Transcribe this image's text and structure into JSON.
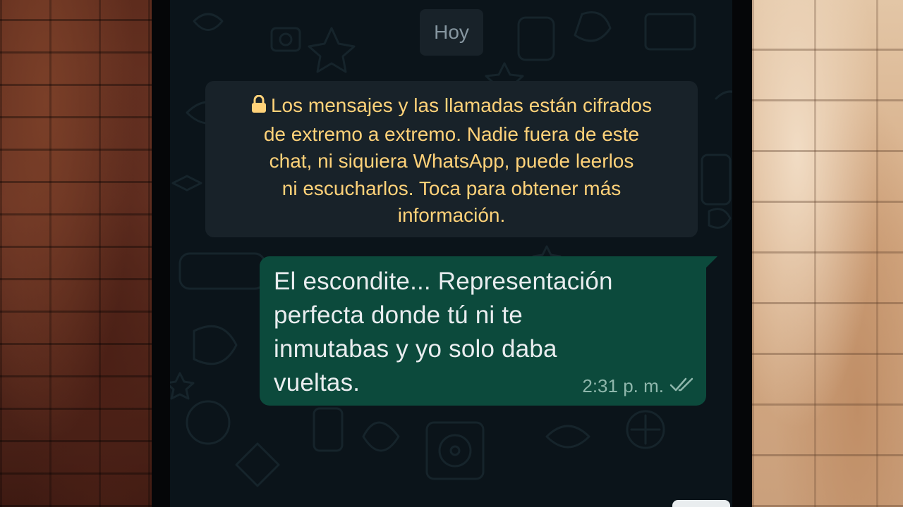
{
  "chat": {
    "date_label": "Hoy",
    "encryption_notice": {
      "lines": [
        "Los mensajes y las llamadas están cifrados",
        "de extremo a extremo. Nadie fuera de este",
        "chat, ni siquiera WhatsApp, puede leerlos",
        "ni escucharlos. Toca para obtener más",
        "información."
      ],
      "icon": "lock-icon",
      "color": "#ffd279"
    },
    "messages": [
      {
        "direction": "outgoing",
        "lines": [
          "El escondite... Representación",
          "perfecta donde tú ni te",
          "inmutabas y yo solo daba",
          "vueltas."
        ],
        "time": "2:31 p. m.",
        "status_icon": "double-check-icon",
        "bubble_color": "#0c4a3c"
      }
    ]
  },
  "colors": {
    "chat_background": "#0b141a",
    "system_chip": "#182229",
    "text_primary": "#e9edef",
    "text_secondary": "#8696a0"
  }
}
